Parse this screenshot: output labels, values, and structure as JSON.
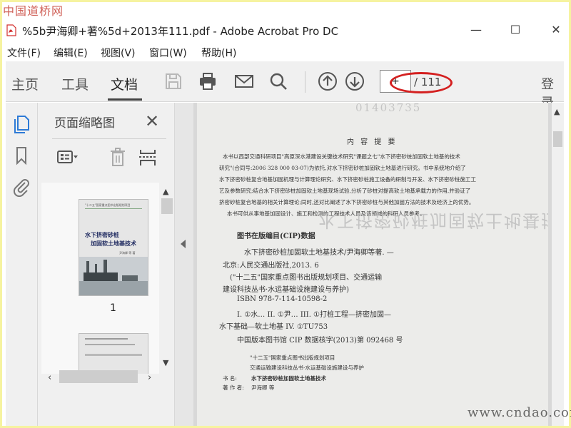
{
  "watermark_top": "中国道桥网",
  "watermark_bottom": "www.cndao.com",
  "window": {
    "title": "%5b尹海卿+著%5d+2013年111.pdf - Adobe Acrobat Pro DC",
    "minimize": "—",
    "maximize": "☐",
    "close": "✕"
  },
  "menu": {
    "file": "文件(F)",
    "edit": "编辑(E)",
    "view": "视图(V)",
    "window": "窗口(W)",
    "help": "帮助(H)"
  },
  "toolbar": {
    "home": "主页",
    "tools": "工具",
    "document": "文档",
    "current_page": "+",
    "total_pages": "/ 111",
    "sign_in": "登录"
  },
  "thumb_panel": {
    "title": "页面缩略图",
    "close": "✕",
    "page1_number": "1",
    "page1_cover_line1": "水下挤密砂桩",
    "page1_cover_line2": "加固软土地基技术",
    "page1_cover_header": "\"十二五\"国家重点图书出版规划项目",
    "page1_cover_author": "尹海卿 等 著"
  },
  "document": {
    "serial": "01403735",
    "ghost_title": "水下挤密砂桩加固软土地基技术",
    "summary_title": "内 容 提 要",
    "summary_lines": [
      "本书以西部交通科研项目\"高原深水港建设关键技术研究\"课题之七\"水下挤密砂桩加固软土地基的技术",
      "研究\"(合同号:2006 328 000 03-07)为依托,对水下挤密砂桩加固软土地基进行研究。书中系统地介绍了",
      "水下挤密砂桩复合地基加固机理与计算理论研究、水下挤密砂桩施工设备的研制与开发、水下挤密砂桩施工工",
      "艺及参数研究;结合水下挤密砂桩加固软土地基现场试验,分析了砂桩对提高软土地基承载力的作用,并验证了",
      "挤密砂桩复合地基的相关计算理论;同时,还对比阐述了水下挤密砂桩与其他加固方法的技术及经济上的优势。",
      "本书可供从事地基加固设计、施工和检测的工程技术人员及该领域的科研人员参考。"
    ],
    "cip_title": "图书在版编目(CIP)数据",
    "cip_lines": [
      "水下挤密砂桩加固软土地基技术/尹海卿等著. —",
      "北京:人民交通出版社,2013. 6",
      "(\"十二五\"国家重点图书出版规划项目、交通运输",
      "建设科技丛书·水运基础设施建设与养护)",
      "ISBN 978-7-114-10598-2",
      "I. ①水…  II. ①尹…  III. ①打桩工程—挤密加固—",
      "水下基础—软土地基  IV. ①TU753",
      "中国版本图书馆 CIP 数据核字(2013)第 092468 号"
    ],
    "series_lines": [
      "\"十二五\"国家重点图书出版规划项目",
      "交通运输建设科技丛书·水运基础设施建设与养护"
    ],
    "book_label": "书    名:",
    "book_name": "水下挤密砂桩加固软土地基技术",
    "author_label": "著 作 者:",
    "author_name": "尹海卿 等"
  }
}
